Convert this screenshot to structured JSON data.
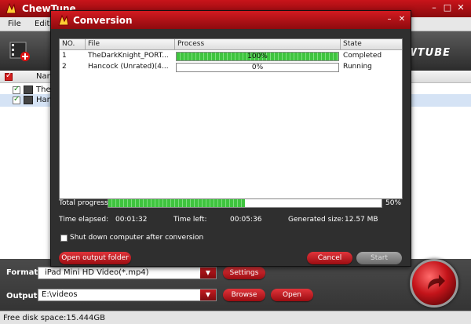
{
  "app": {
    "title": "ChewTune",
    "menu": [
      "File",
      "Edit"
    ],
    "brand": "CHEWTUBE",
    "file_list": {
      "header_name": "Nam",
      "rows": [
        {
          "name": "The"
        },
        {
          "name": "Han"
        }
      ]
    },
    "format_label": "Format:",
    "format_value": "iPad Mini HD Video(*.mp4)",
    "settings_label": "Settings",
    "output_label": "Output:",
    "output_value": "E:\\videos",
    "browse_label": "Browse",
    "open_label": "Open",
    "status": "Free disk space:15.444GB"
  },
  "dialog": {
    "title": "Conversion",
    "table": {
      "headers": [
        "NO.",
        "File",
        "Process",
        "State"
      ],
      "rows": [
        {
          "no": "1",
          "file": "TheDarkKnight_PORT...",
          "progress": 100,
          "progress_text": "100%",
          "state": "Completed"
        },
        {
          "no": "2",
          "file": "Hancock (Unrated)(4...",
          "progress": 0,
          "progress_text": "0%",
          "state": "Running"
        }
      ]
    },
    "total_progress_label": "Total progress:",
    "total_progress": 50,
    "total_progress_text": "50%",
    "time_elapsed_label": "Time elapsed:",
    "time_elapsed": "00:01:32",
    "time_left_label": "Time left:",
    "time_left": "00:05:36",
    "generated_size_label": "Generated size:",
    "generated_size": "12.57 MB",
    "shutdown_label": "Shut down computer after conversion",
    "open_output_folder_label": "Open output folder",
    "cancel_label": "Cancel",
    "start_label": "Start"
  },
  "colors": {
    "accent_red": "#c4141a",
    "progress_green": "#3fc43f"
  }
}
